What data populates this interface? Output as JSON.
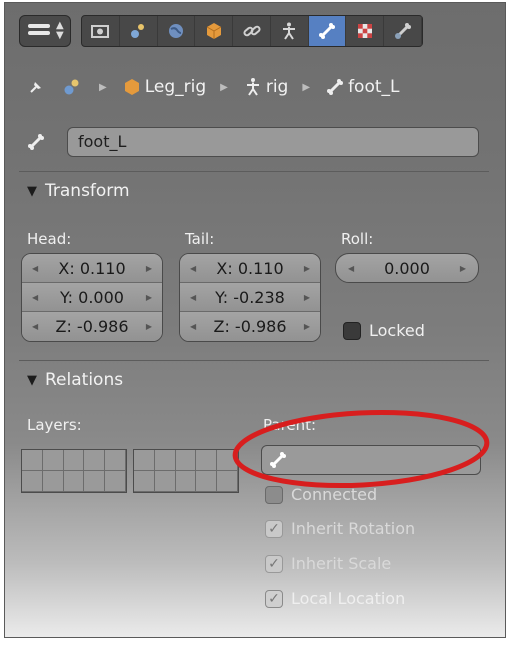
{
  "toolbar": {
    "tabs": [
      {
        "icon": "render-icon"
      },
      {
        "icon": "scene-icon"
      },
      {
        "icon": "world-icon"
      },
      {
        "icon": "object-icon"
      },
      {
        "icon": "constraints-icon"
      },
      {
        "icon": "armature-icon"
      },
      {
        "icon": "bone-icon",
        "active": true
      },
      {
        "icon": "material-icon"
      },
      {
        "icon": "bone-constraint-icon"
      }
    ]
  },
  "breadcrumb": {
    "object": "Leg_rig",
    "armature": "rig",
    "bone": "foot_L"
  },
  "bone_name": "foot_L",
  "transform": {
    "title": "Transform",
    "head_label": "Head:",
    "tail_label": "Tail:",
    "roll_label": "Roll:",
    "head": {
      "x": "X: 0.110",
      "y": "Y: 0.000",
      "z": "Z: -0.986"
    },
    "tail": {
      "x": "X: 0.110",
      "y": "Y: -0.238",
      "z": "Z: -0.986"
    },
    "roll": "0.000",
    "locked_label": "Locked"
  },
  "relations": {
    "title": "Relations",
    "layers_label": "Layers:",
    "parent_label": "Parent:",
    "connected_label": "Connected",
    "inherit_rotation_label": "Inherit Rotation",
    "inherit_scale_label": "Inherit Scale",
    "local_location_label": "Local Location"
  },
  "colors": {
    "active_tab": "#5680c2",
    "highlight_ring": "#d81e1e"
  }
}
